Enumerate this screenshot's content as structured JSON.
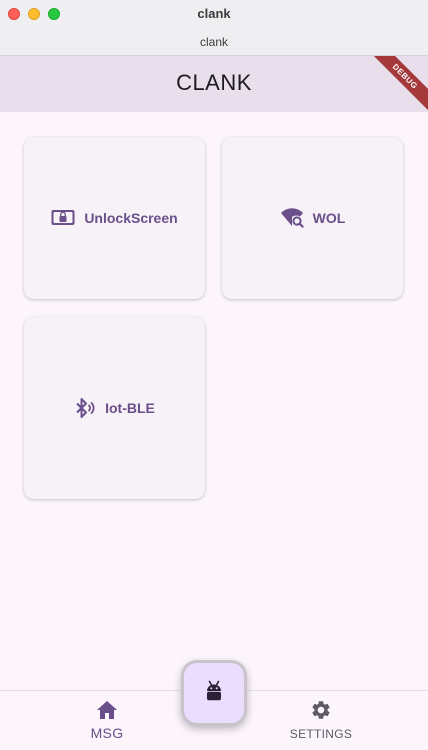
{
  "window": {
    "title": "clank",
    "subtitle": "clank"
  },
  "appbar": {
    "title": "CLANK",
    "debug_banner": "DEBUG"
  },
  "cards": [
    {
      "label": "UnlockScreen",
      "icon": "screen-lock-icon"
    },
    {
      "label": "WOL",
      "icon": "wifi-find-icon"
    },
    {
      "label": "Iot-BLE",
      "icon": "bluetooth-audio-icon"
    }
  ],
  "bottom_nav": {
    "items": [
      {
        "label": "MSG",
        "icon": "home-icon",
        "active": true
      },
      {
        "label": "SETTINGS",
        "icon": "gear-icon",
        "active": false
      }
    ],
    "fab_icon": "android-icon"
  },
  "colors": {
    "accent": "#6a4f8b",
    "appbar": "#e9dfec",
    "background": "#fcf5fc",
    "card": "#f7f2f7",
    "fab": "#eaddfe",
    "debug_ribbon": "#a4383b"
  }
}
